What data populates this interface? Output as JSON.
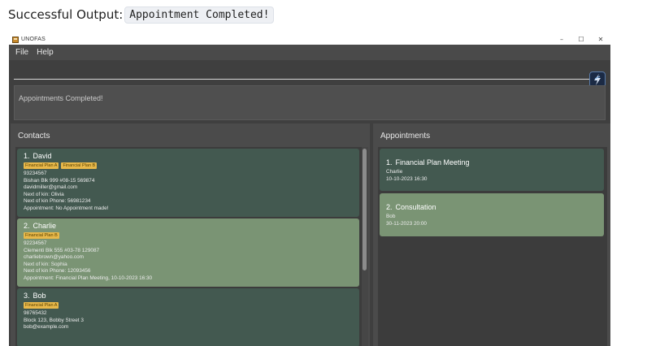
{
  "caption": {
    "label": "Successful Output:",
    "code": "Appointment Completed!"
  },
  "window": {
    "title": "UNOFAS",
    "controls": {
      "minimize": "–",
      "maximize": "☐",
      "close": "✕"
    }
  },
  "menu": {
    "file": "File",
    "help": "Help"
  },
  "command": {
    "value": "",
    "placeholder": ""
  },
  "result": {
    "text": "Appointments Completed!"
  },
  "contacts": {
    "header": "Contacts",
    "items": [
      {
        "index": "1.",
        "name": "David",
        "tags": [
          "Financial Plan A",
          "Financial Plan B"
        ],
        "phone": "93234567",
        "address": "Bishan Blk 999 #08-15 569874",
        "email": "davidmiller@gmail.com",
        "nok": "Next of kin: Olivia",
        "nok_phone": "Next of kin Phone: 56981234",
        "appointment": "Appointment: No Appointment made!"
      },
      {
        "index": "2.",
        "name": "Charlie",
        "tags": [
          "Financial Plan B"
        ],
        "phone": "92234567",
        "address": "Clementi Blk 555 #03-78 129087",
        "email": "charliebrown@yahoo.com",
        "nok": "Next of kin: Sophia",
        "nok_phone": "Next of kin Phone: 12093456",
        "appointment": "Appointment: Financial Plan Meeting, 10-10-2023 16:30"
      },
      {
        "index": "3.",
        "name": "Bob",
        "tags": [
          "Financial Plan A"
        ],
        "phone": "98765432",
        "address": "Block 123, Bobby Street 3",
        "email": "bob@example.com"
      }
    ]
  },
  "appointments": {
    "header": "Appointments",
    "items": [
      {
        "index": "1.",
        "title": "Financial Plan Meeting",
        "person": "Charlie",
        "datetime": "10-10-2023 16:30"
      },
      {
        "index": "2.",
        "title": "Consultation",
        "person": "Bob",
        "datetime": "30-11-2023 20:00"
      }
    ]
  },
  "colors": {
    "card_dark": "#435950",
    "card_selected": "#7a9474",
    "tag": "#e8b84a",
    "background": "#3f3f3f"
  },
  "icons": {
    "app": "app-logo-icon",
    "execute": "lightning-icon"
  }
}
